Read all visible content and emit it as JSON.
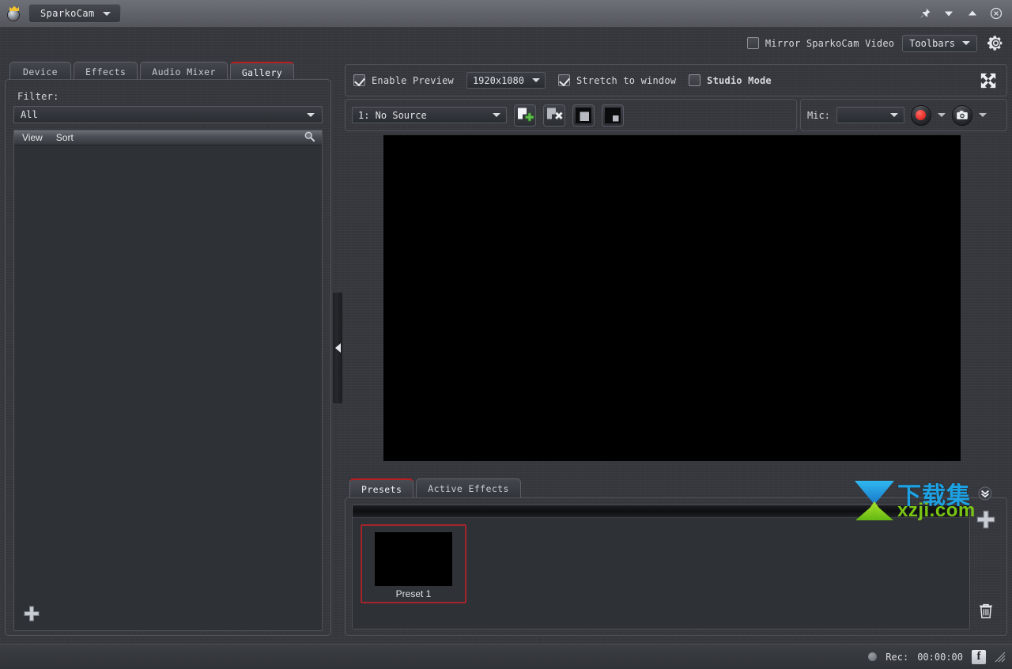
{
  "window": {
    "app_name": "SparkoCam",
    "title_menu_label": "SparkoCam",
    "controls": [
      "pin-icon",
      "minimize-down-icon",
      "restore-up-icon",
      "close-icon"
    ]
  },
  "ribbon": {
    "mirror_checkbox_label": "Mirror SparkoCam Video",
    "mirror_checked": false,
    "toolbars_label": "Toolbars",
    "settings_icon": "gear-icon"
  },
  "left_panel": {
    "tabs": [
      {
        "label": "Device",
        "active": false
      },
      {
        "label": "Effects",
        "active": false
      },
      {
        "label": "Audio Mixer",
        "active": false
      },
      {
        "label": "Gallery",
        "active": true
      }
    ],
    "filter_label": "Filter:",
    "filter_value": "All",
    "list_header": {
      "view_label": "View",
      "sort_label": "Sort",
      "search_icon": "search-icon"
    },
    "items": [],
    "add_icon": "plus-icon"
  },
  "splitter": {
    "collapse_icon": "chevron-left-icon"
  },
  "preview_toolbar": {
    "enable_preview_label": "Enable Preview",
    "enable_preview_checked": true,
    "resolution_value": "1920x1080",
    "stretch_label": "Stretch to window",
    "stretch_checked": true,
    "studio_mode_label": "Studio Mode",
    "studio_mode_checked": false,
    "expand_icon": "fullscreen-expand-icon"
  },
  "source_bar": {
    "source_value": "1: No Source",
    "buttons": [
      {
        "icon": "add-source-icon",
        "label": "Add source"
      },
      {
        "icon": "remove-source-icon",
        "label": "Remove source"
      },
      {
        "icon": "source-up-icon",
        "label": "Source order up"
      },
      {
        "icon": "source-down-icon",
        "label": "Source order down"
      }
    ]
  },
  "record_bar": {
    "mic_label": "Mic:",
    "mic_value": "",
    "record_icon": "record-icon",
    "snapshot_icon": "camera-icon"
  },
  "bottom_panel": {
    "tabs": [
      {
        "label": "Presets",
        "active": true
      },
      {
        "label": "Active Effects",
        "active": false
      }
    ],
    "presets": [
      {
        "label": "Preset 1",
        "selected": true
      }
    ],
    "add_icon": "plus-icon",
    "delete_icon": "trash-icon",
    "collapse_icon": "chevron-double-down-icon"
  },
  "watermark": {
    "cn_text": "下载集",
    "en_text": "xzji.com",
    "cn_color": "#1da1e2",
    "en_color": "#7ac514"
  },
  "statusbar": {
    "rec_label": "Rec:",
    "rec_time": "00:00:00",
    "facebook_glyph": "f"
  },
  "colors": {
    "accent_red": "#b81d1f",
    "panel_bg": "#35373d",
    "preview_bg": "#000000",
    "record_red": "#e8322d",
    "add_green": "#5fbf4a"
  }
}
